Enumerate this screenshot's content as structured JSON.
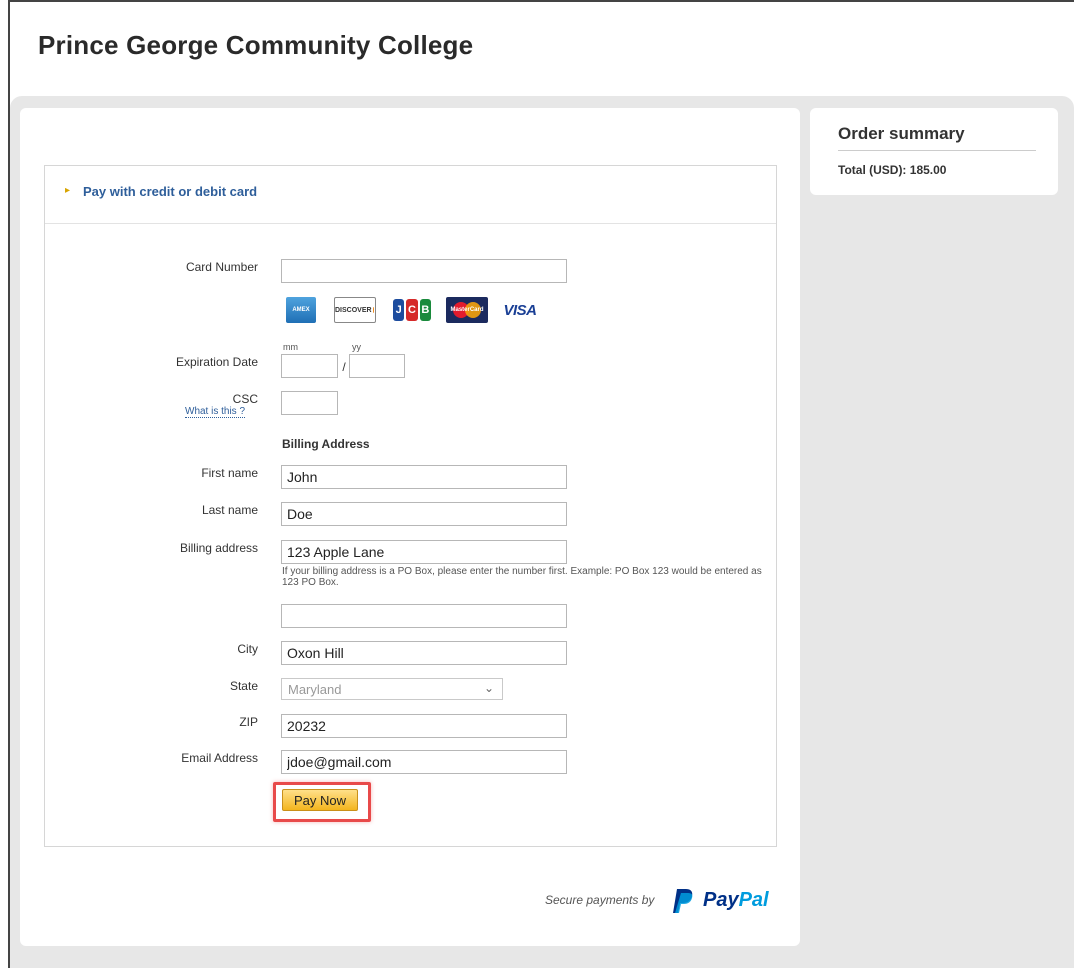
{
  "site": {
    "title": "Prince George Community College"
  },
  "payment": {
    "header_label": "Pay with credit or debit card",
    "card_number_label": "Card Number",
    "card_number_value": "",
    "card_brands": [
      "AMEX",
      "DISCOVER",
      "JCB",
      "MasterCard",
      "VISA"
    ],
    "expiration_label": "Expiration Date",
    "mm_label": "mm",
    "yy_label": "yy",
    "exp_separator": "/",
    "csc_label": "CSC",
    "csc_help": "What is this ?",
    "billing_heading": "Billing Address",
    "first_name_label": "First name",
    "first_name_value": "John",
    "last_name_label": "Last name",
    "last_name_value": "Doe",
    "billing_address_label": "Billing address",
    "billing_address_value": "123 Apple Lane",
    "billing_note": "If your billing address is a PO Box, please enter the number first. Example: PO Box 123 would be entered as 123 PO Box.",
    "billing_address2_value": "",
    "city_label": "City",
    "city_value": "Oxon Hill",
    "state_label": "State",
    "state_value": "Maryland",
    "zip_label": "ZIP",
    "zip_value": "20232",
    "email_label": "Email Address",
    "email_value": "jdoe@gmail.com",
    "pay_button": "Pay Now"
  },
  "footer": {
    "secure_text": "Secure payments by",
    "paypal_pay": "Pay",
    "paypal_pal": "Pal"
  },
  "summary": {
    "title": "Order summary",
    "total": "Total (USD): 185.00"
  },
  "colors": {
    "link_blue": "#2e5e9a",
    "highlight_red": "#e84a4a",
    "button_gold": "#f3b51e",
    "paypal_dark": "#003087",
    "paypal_light": "#009cde"
  }
}
